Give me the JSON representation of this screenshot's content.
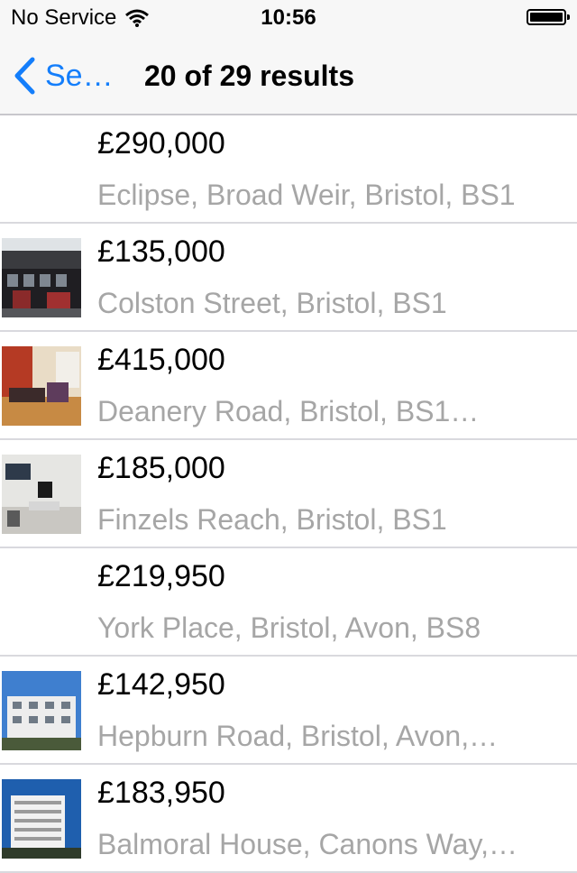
{
  "status_bar": {
    "carrier": "No Service",
    "time": "10:56"
  },
  "nav": {
    "back_label": "Se…",
    "title": "20 of 29 results",
    "accent_color": "#147efb"
  },
  "listings": [
    {
      "price": "£290,000",
      "address": "Eclipse, Broad Weir, Bristol, BS1",
      "thumbnail": "none"
    },
    {
      "price": "£135,000",
      "address": "Colston Street, Bristol, BS1",
      "thumbnail": "building-facade"
    },
    {
      "price": "£415,000",
      "address": "Deanery Road, Bristol, BS1…",
      "thumbnail": "living-room"
    },
    {
      "price": "£185,000",
      "address": "Finzels Reach, Bristol, BS1",
      "thumbnail": "office-interior"
    },
    {
      "price": "£219,950",
      "address": "York Place, Bristol, Avon, BS8",
      "thumbnail": "none"
    },
    {
      "price": "£142,950",
      "address": "Hepburn Road, Bristol, Avon,…",
      "thumbnail": "apartment-block"
    },
    {
      "price": "£183,950",
      "address": "Balmoral House, Canons Way,…",
      "thumbnail": "tower-block"
    }
  ]
}
